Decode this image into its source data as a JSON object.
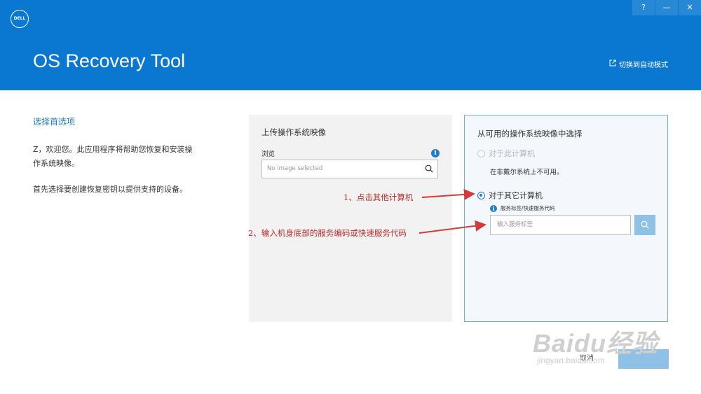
{
  "header": {
    "logo_text": "DELL",
    "title": "OS Recovery Tool",
    "auto_mode": "切换到自动模式",
    "help_glyph": "?",
    "minimize_glyph": "—",
    "close_glyph": "✕",
    "background": "#0a78d0"
  },
  "intro": {
    "heading": "选择首选项",
    "para1": "Z，欢迎您。此应用程序将帮助您恢复和安装操作系统映像。",
    "para2": "首先选择要创建恢复密钥以提供支持的设备。"
  },
  "upload_panel": {
    "title": "上传操作系统映像",
    "browse_label": "浏览",
    "placeholder": "No image selected"
  },
  "select_panel": {
    "title": "从可用的操作系统映像中选择",
    "option_this": "对于此计算机",
    "not_available": "在非戴尔系统上不可用。",
    "option_other": "对于其它计算机",
    "service_label": "服务标签/快速服务代码",
    "service_placeholder": "输入服务标签"
  },
  "footer": {
    "cancel": "取消"
  },
  "annotations": {
    "step1": "1、点击其他计算机",
    "step2": "2、输入机身底部的服务编码或快速服务代码",
    "color": "#d33a3a"
  },
  "watermark": {
    "brand": "Baidu经验",
    "url": "jingyan.baidu.com"
  }
}
